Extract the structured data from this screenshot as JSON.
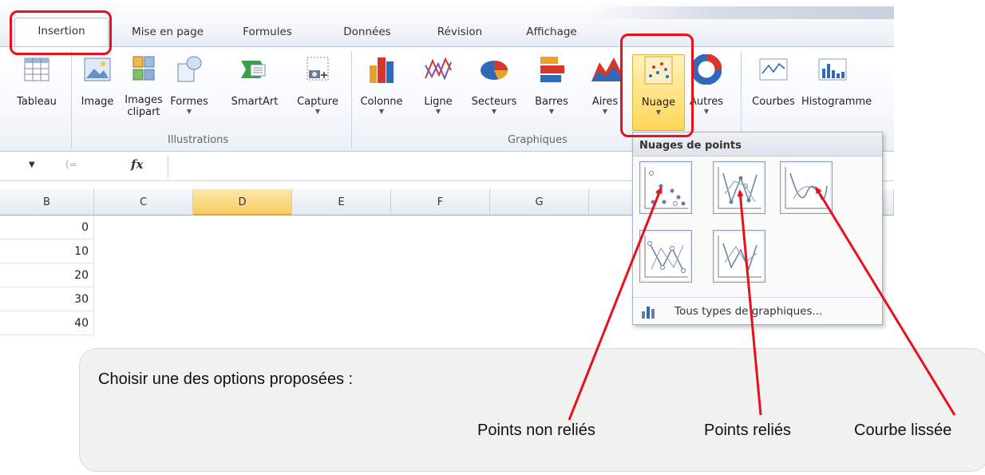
{
  "ribbon": {
    "tabs": [
      "Insertion",
      "Mise en page",
      "Formules",
      "Données",
      "Révision",
      "Affichage"
    ],
    "buttons": {
      "tableau": "Tableau",
      "image": "Image",
      "images_clipart_1": "Images",
      "images_clipart_2": "clipart",
      "formes": "Formes",
      "smartart": "SmartArt",
      "capture": "Capture",
      "colonne": "Colonne",
      "ligne": "Ligne",
      "secteurs": "Secteurs",
      "barres": "Barres",
      "aires": "Aires",
      "nuage": "Nuage",
      "autres": "Autres",
      "courbes": "Courbes",
      "histogramme": "Histogramme"
    },
    "groups": {
      "illustrations": "Illustrations",
      "graphiques": "Graphiques"
    }
  },
  "formula_bar": {
    "fx": "fx"
  },
  "grid": {
    "columns": [
      "B",
      "C",
      "D",
      "E",
      "F",
      "G"
    ],
    "values": [
      "0",
      "10",
      "20",
      "30",
      "40"
    ]
  },
  "dropdown": {
    "title": "Nuages de points",
    "footer": "Tous types de graphiques..."
  },
  "callout": {
    "text": "Choisir une des options proposées :",
    "labels": [
      "Points non reliés",
      "Points reliés",
      "Courbe lissée"
    ]
  },
  "colors": {
    "highlight": "#e8101c",
    "selected_fill": "#ffd65a"
  }
}
